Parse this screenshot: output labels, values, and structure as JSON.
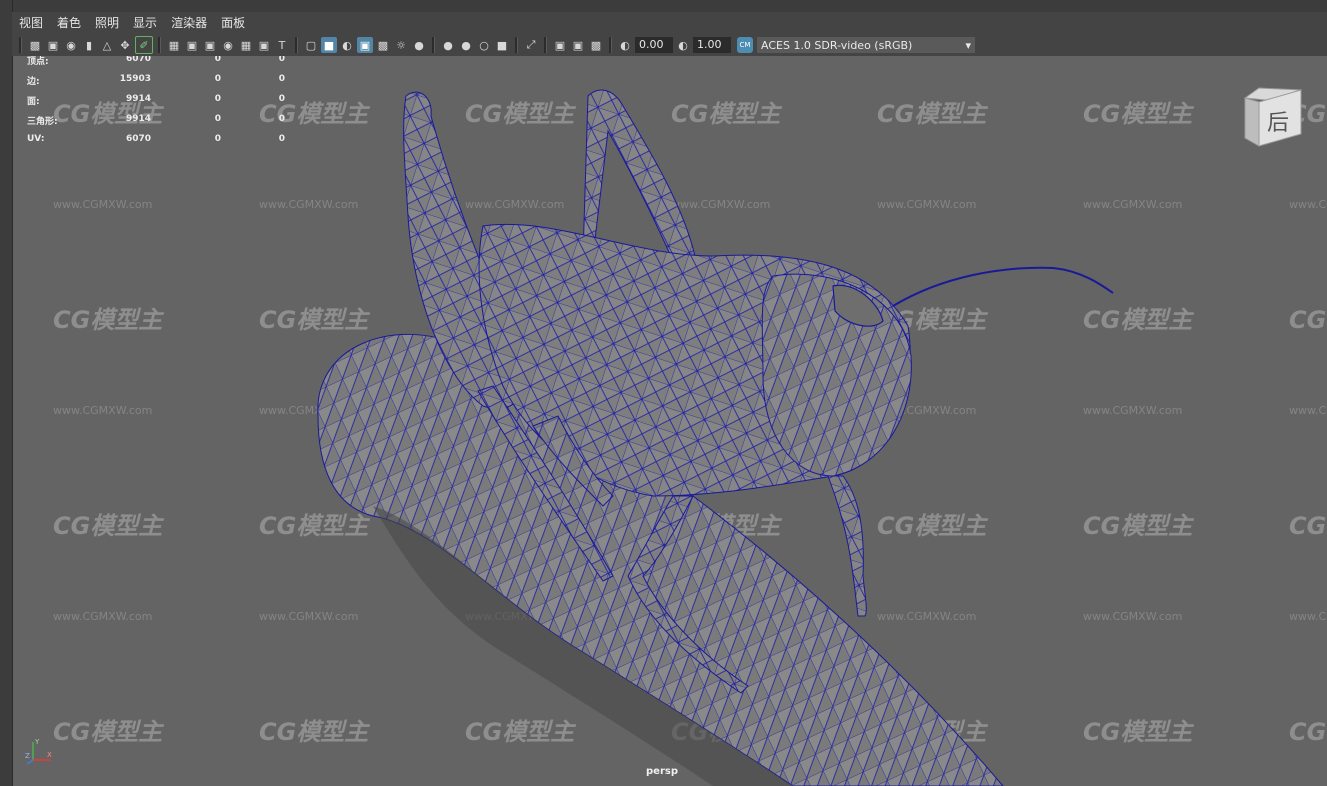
{
  "menu": [
    "视图",
    "着色",
    "照明",
    "显示",
    "渲染器",
    "面板"
  ],
  "toolbar": {
    "exposure_value": "0.00",
    "gamma_value": "1.00",
    "colorspace": "ACES 1.0 SDR-video (sRGB)",
    "ocio_badge": "CM",
    "icons": [
      "camera-icon",
      "camera-attr-icon",
      "bookmark-icon",
      "image-plane-icon",
      "grid-icon",
      "film-gate-icon",
      "resolution-gate-icon",
      "gate-mask-icon",
      "field-chart-icon",
      "safe-action-icon",
      "safe-title-icon",
      "wireframe-icon",
      "smooth-shade-icon",
      "default-material-icon",
      "wireframe-on-shaded-icon",
      "xray-icon",
      "use-lights-icon",
      "shadows-icon",
      "ssao-icon",
      "motion-blur-icon",
      "anti-alias-icon",
      "dof-icon",
      "isolate-icon",
      "xray-joints-icon",
      "xray-active-icon",
      "backface-icon",
      "exposure-icon",
      "gamma-icon"
    ]
  },
  "hud": {
    "rows": [
      {
        "label": "顶点:",
        "v1": "6070",
        "v2": "0",
        "v3": "0"
      },
      {
        "label": "边:",
        "v1": "15903",
        "v2": "0",
        "v3": "0"
      },
      {
        "label": "面:",
        "v1": "9914",
        "v2": "0",
        "v3": "0"
      },
      {
        "label": "三角形:",
        "v1": "9914",
        "v2": "0",
        "v3": "0"
      },
      {
        "label": "UV:",
        "v1": "6070",
        "v2": "0",
        "v3": "0"
      }
    ]
  },
  "watermark": {
    "logo": "CG模型主",
    "url": "www.CGMXW.com"
  },
  "viewcube_label": "后",
  "camera_label": "persp",
  "axis": {
    "x": "X",
    "y": "Y",
    "z": "Z"
  },
  "colors": {
    "viewport_bg": "#646464",
    "wireframe": "#1a1aa0",
    "mesh_fill": "#7d7d7d",
    "active_icon": "#5285a6"
  }
}
